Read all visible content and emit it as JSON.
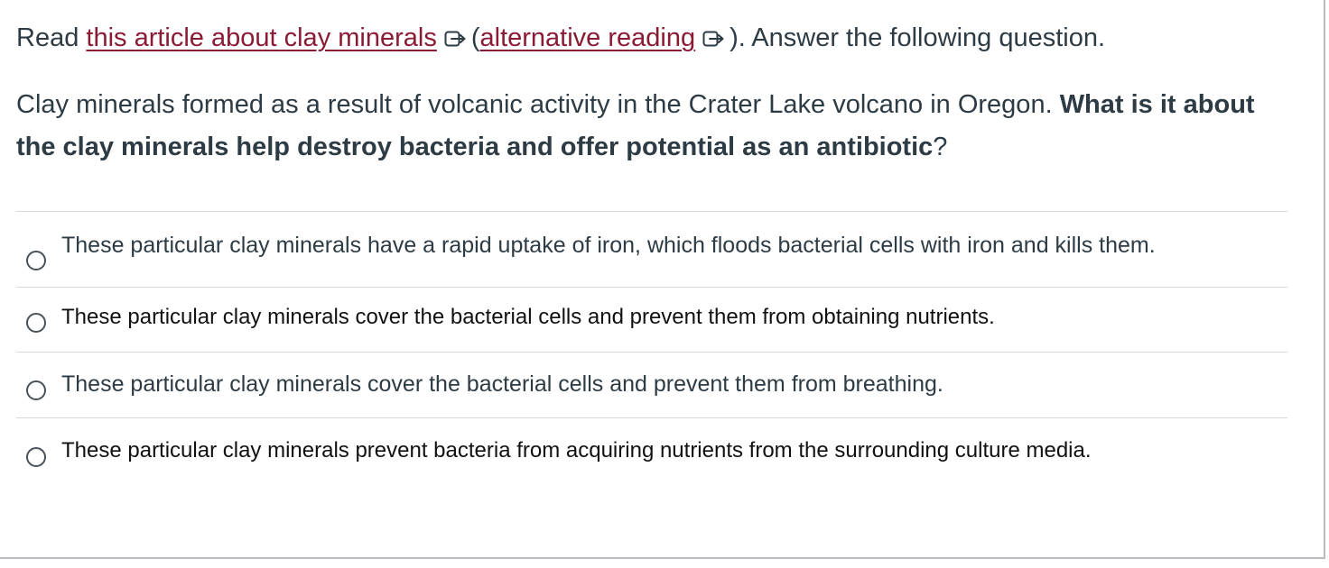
{
  "question": {
    "read_prefix": "Read",
    "link_main": "this article about clay minerals",
    "paren_open": "(",
    "link_alt": "alternative reading",
    "read_suffix": "). Answer the following question.",
    "body_plain": "Clay minerals formed as a result of volcanic activity in the Crater Lake volcano in Oregon.",
    "body_bold": "What is it about the clay minerals help destroy bacteria and offer potential as an antibiotic",
    "body_end": "?"
  },
  "answers": [
    {
      "label": "These particular clay minerals have a rapid uptake of iron, which floods bacterial cells with iron and kills them.",
      "selected": false
    },
    {
      "label": "These particular clay minerals cover the bacterial cells and prevent them from obtaining nutrients.",
      "selected": false
    },
    {
      "label": "These particular clay minerals cover the bacterial cells and prevent them from breathing.",
      "selected": false
    },
    {
      "label": "These particular clay minerals prevent bacteria from acquiring nutrients from the surrounding culture media.",
      "selected": false
    }
  ],
  "colors": {
    "link": "#8b1a35",
    "text": "#2d3b45",
    "divider": "#d7dadc"
  },
  "icons": {
    "external_link": "external-link-icon",
    "radio": "radio-unchecked-icon"
  }
}
